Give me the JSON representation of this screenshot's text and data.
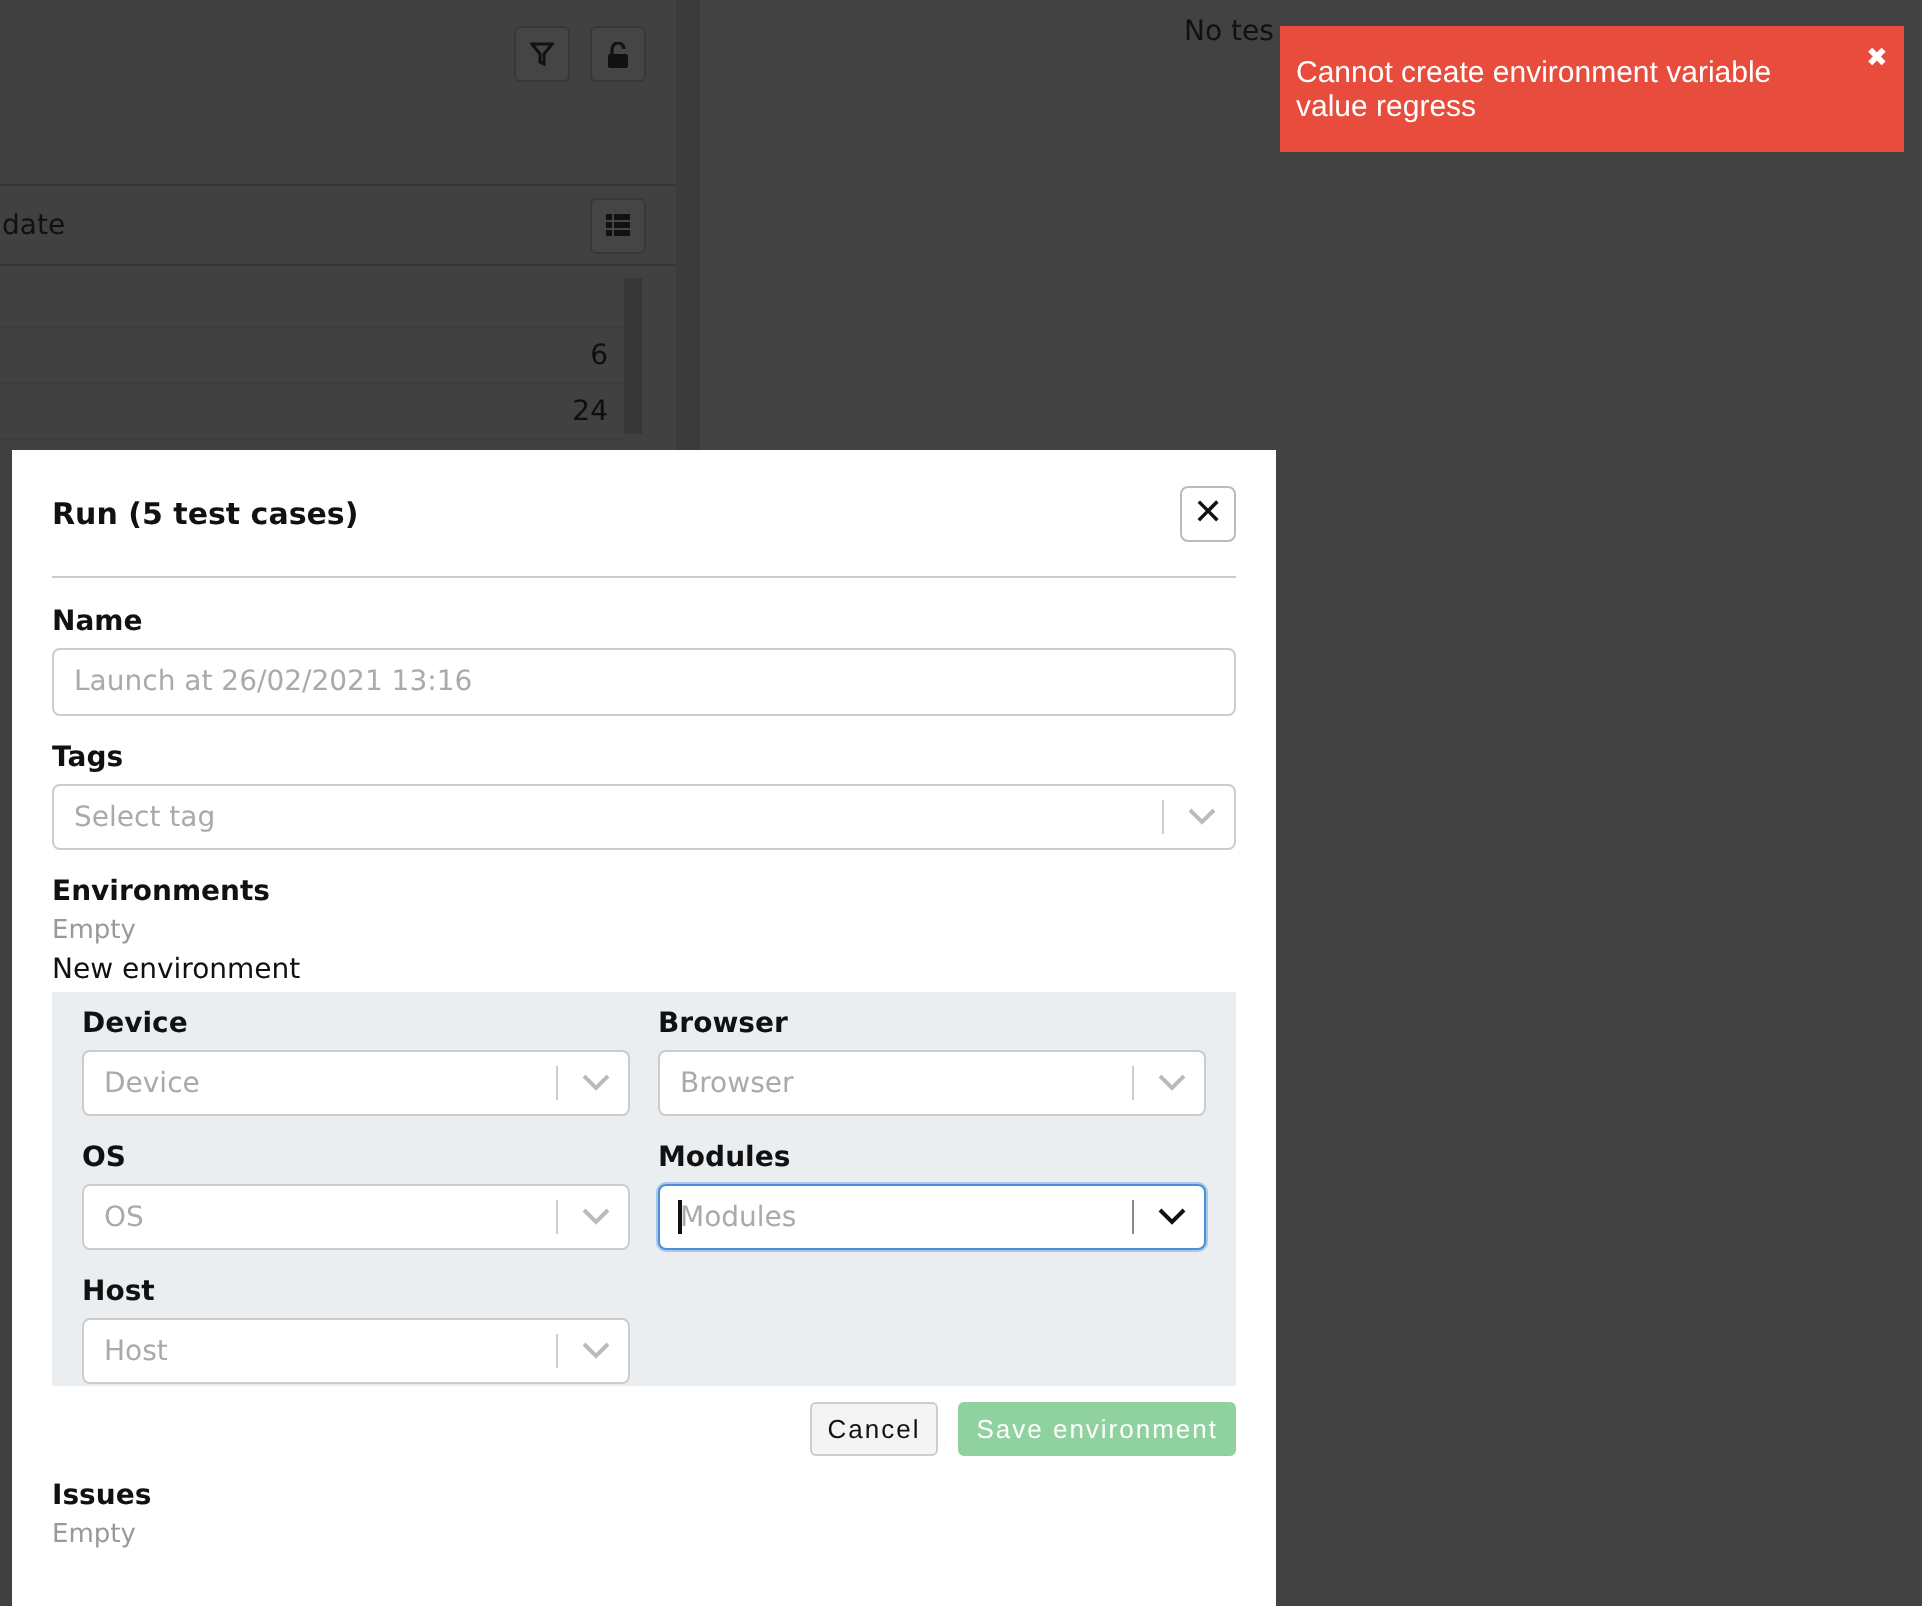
{
  "background_page": {
    "table": {
      "columns": [
        {
          "label": "date"
        }
      ],
      "rows": [
        {
          "value": "6"
        },
        {
          "value": "24"
        }
      ]
    },
    "empty_message": "No tes"
  },
  "modal": {
    "title": "Run (5 test cases)",
    "close": "✕",
    "name": {
      "label": "Name",
      "placeholder": "Launch at 26/02/2021 13:16"
    },
    "tags": {
      "label": "Tags",
      "placeholder": "Select tag"
    },
    "environments": {
      "label": "Environments",
      "empty_text": "Empty",
      "new_label": "New environment",
      "fields": [
        {
          "label": "Device",
          "placeholder": "Device",
          "focused": false
        },
        {
          "label": "Browser",
          "placeholder": "Browser",
          "focused": false
        },
        {
          "label": "OS",
          "placeholder": "OS",
          "focused": false
        },
        {
          "label": "Modules",
          "placeholder": "Modules",
          "focused": true
        },
        {
          "label": "Host",
          "placeholder": "Host",
          "focused": false
        }
      ],
      "buttons": [
        {
          "label": "Cancel",
          "kind": "secondary",
          "disabled": false
        },
        {
          "label": "Save environment",
          "kind": "primary",
          "disabled": true
        }
      ]
    },
    "issues": {
      "label": "Issues",
      "empty_text": "Empty"
    }
  },
  "toast": {
    "message": "Cannot create environment variable value regress",
    "close": "✖"
  }
}
